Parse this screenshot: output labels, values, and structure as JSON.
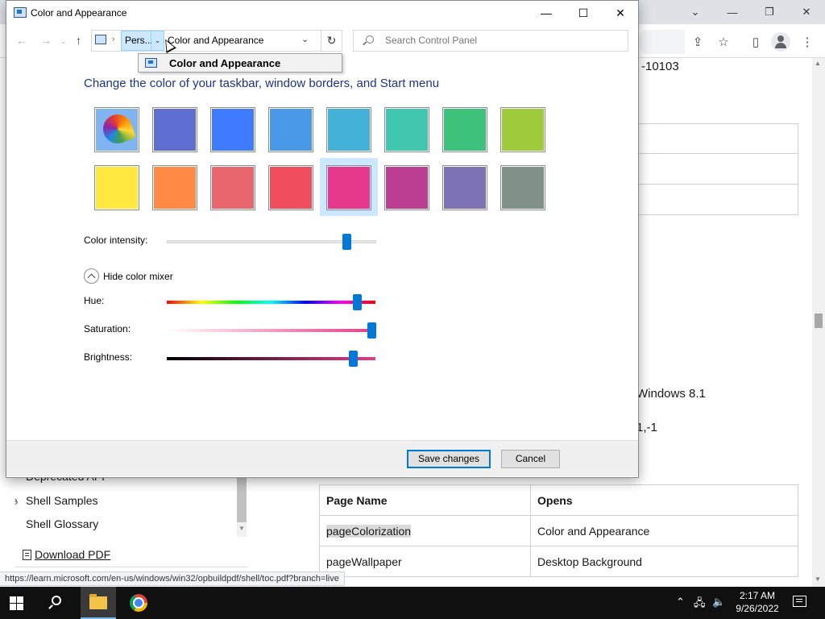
{
  "browser": {
    "fragments": {
      "id_suffix": "-10103",
      "windows_version": "Windows 8.1",
      "value_fragment": "1,-1"
    },
    "toc": {
      "items": [
        {
          "label": "Deprecated API",
          "expandable": true
        },
        {
          "label": "Shell Samples",
          "expandable": true
        },
        {
          "label": "Shell Glossary",
          "expandable": false
        }
      ],
      "download_pdf": "Download PDF"
    },
    "table": {
      "headers": [
        "Page Name",
        "Opens"
      ],
      "rows": [
        {
          "name": "pageColorization",
          "opens": "Color and Appearance",
          "highlighted": true
        },
        {
          "name": "pageWallpaper",
          "opens": "Desktop Background",
          "highlighted": false
        }
      ]
    },
    "status_url": "https://learn.microsoft.com/en-us/windows/win32/opbuildpdf/shell/toc.pdf?branch=live"
  },
  "dialog": {
    "title": "Color and Appearance",
    "nav": {
      "crumb_short": "Pers...",
      "current_location": "Color and Appearance",
      "search_placeholder": "Search Control Panel"
    },
    "crumb_menu_item": "Color and Appearance",
    "heading": "Change the color of your taskbar, window borders, and Start menu",
    "swatches": [
      {
        "name": "automatic",
        "color": "#7fb4f0",
        "icon": "color-palette-icon",
        "selected": false
      },
      {
        "name": "indigo",
        "color": "#5f6fd1",
        "selected": false
      },
      {
        "name": "blue",
        "color": "#3f7bff",
        "selected": false
      },
      {
        "name": "sky-blue",
        "color": "#4a98e8",
        "selected": false
      },
      {
        "name": "teal-blue",
        "color": "#43b0d8",
        "selected": false
      },
      {
        "name": "aqua",
        "color": "#41c7ad",
        "selected": false
      },
      {
        "name": "green",
        "color": "#3ec17a",
        "selected": false
      },
      {
        "name": "lime",
        "color": "#9fcc3d",
        "selected": false
      },
      {
        "name": "yellow",
        "color": "#ffe83f",
        "selected": false
      },
      {
        "name": "orange",
        "color": "#ff8a45",
        "selected": false
      },
      {
        "name": "salmon",
        "color": "#e8676e",
        "selected": false
      },
      {
        "name": "red",
        "color": "#f04d5d",
        "selected": false
      },
      {
        "name": "pink",
        "color": "#e63a8c",
        "selected": true
      },
      {
        "name": "magenta",
        "color": "#bb3e92",
        "selected": false
      },
      {
        "name": "purple",
        "color": "#7d72b3",
        "selected": false
      },
      {
        "name": "gray",
        "color": "#80918a",
        "selected": false
      }
    ],
    "intensity": {
      "label": "Color intensity:",
      "value": 0.86
    },
    "mixer_toggle_label": "Hide color mixer",
    "hue": {
      "label": "Hue:",
      "value": 0.91
    },
    "saturation": {
      "label": "Saturation:",
      "value": 0.98
    },
    "brightness": {
      "label": "Brightness:",
      "value": 0.89
    },
    "save_label": "Save changes",
    "cancel_label": "Cancel"
  },
  "taskbar": {
    "time": "2:17 AM",
    "date": "9/26/2022"
  }
}
